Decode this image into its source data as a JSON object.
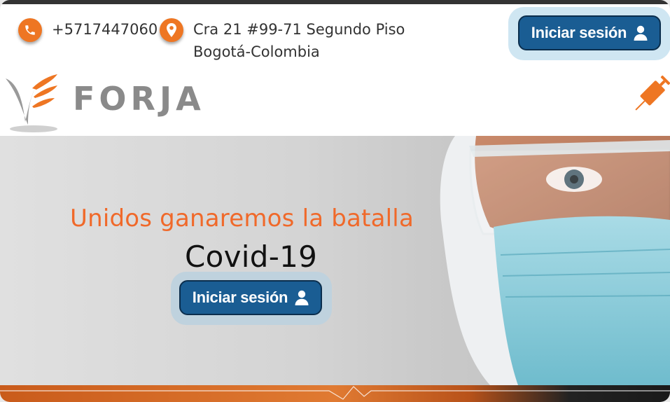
{
  "contact": {
    "phone": "+5717447060",
    "address_line1": "Cra 21 #99-71 Segundo Piso",
    "address_line2": "Bogotá-Colombia"
  },
  "header": {
    "login_label": "Iniciar sesión",
    "logo_text": "FORJA"
  },
  "hero": {
    "headline": "Unidos ganaremos la batalla",
    "subheadline": "Covid-19",
    "login_label": "Iniciar sesión"
  },
  "colors": {
    "accent_orange": "#ee7623",
    "headline_orange": "#f0692a",
    "button_blue": "#1a5d93",
    "button_halo": "#cfe6f2"
  },
  "icons": [
    "phone-icon",
    "location-pin-icon",
    "user-icon",
    "syringe-icon"
  ]
}
